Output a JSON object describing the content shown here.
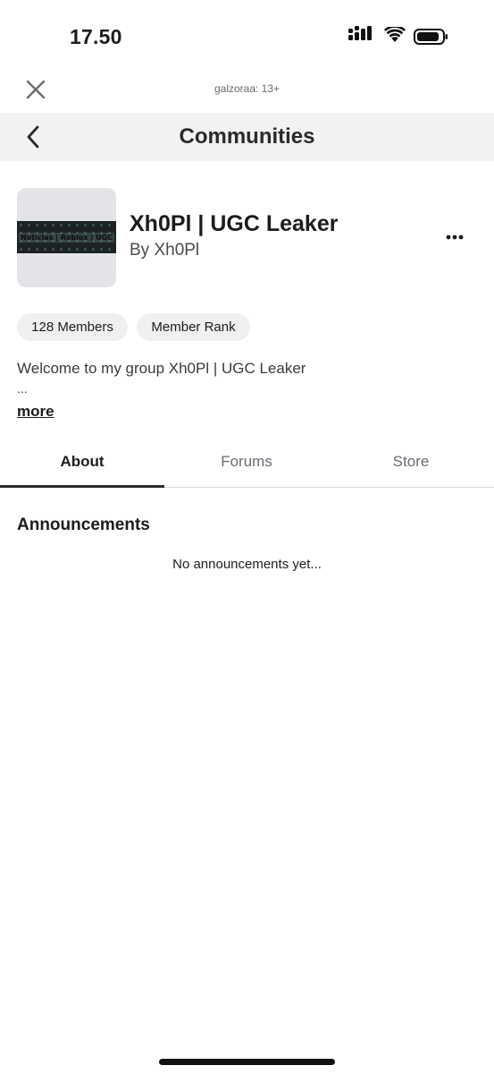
{
  "status_bar": {
    "time": "17.50",
    "icons": [
      "cellular-signal-icon",
      "wifi-icon",
      "battery-icon"
    ]
  },
  "header": {
    "account_label": "galzoraa: 13+",
    "close_icon": "close-icon"
  },
  "nav": {
    "title": "Communities",
    "back_icon": "chevron-left-icon"
  },
  "group": {
    "thumbnail_text": "Noticias | Roblox | UGC",
    "name": "Xh0Pl | UGC Leaker",
    "owner": "By Xh0Pl",
    "more_icon": "more-horizontal-icon"
  },
  "chips": {
    "members": "128 Members",
    "rank": "Member Rank"
  },
  "description": {
    "text": "Welcome to my group Xh0Pl | UGC Leaker",
    "ellipsis": "...",
    "more_label": "more"
  },
  "tabs": [
    {
      "label": "About",
      "active": true
    },
    {
      "label": "Forums",
      "active": false
    },
    {
      "label": "Store",
      "active": false
    }
  ],
  "announcements": {
    "title": "Announcements",
    "empty_text": "No announcements yet..."
  },
  "colors": {
    "nav_background": "#f2f2f3",
    "chip_background": "#f0f0f2",
    "tab_indicator": "#2b2b2f",
    "inactive_tab": "#6b6b73"
  }
}
